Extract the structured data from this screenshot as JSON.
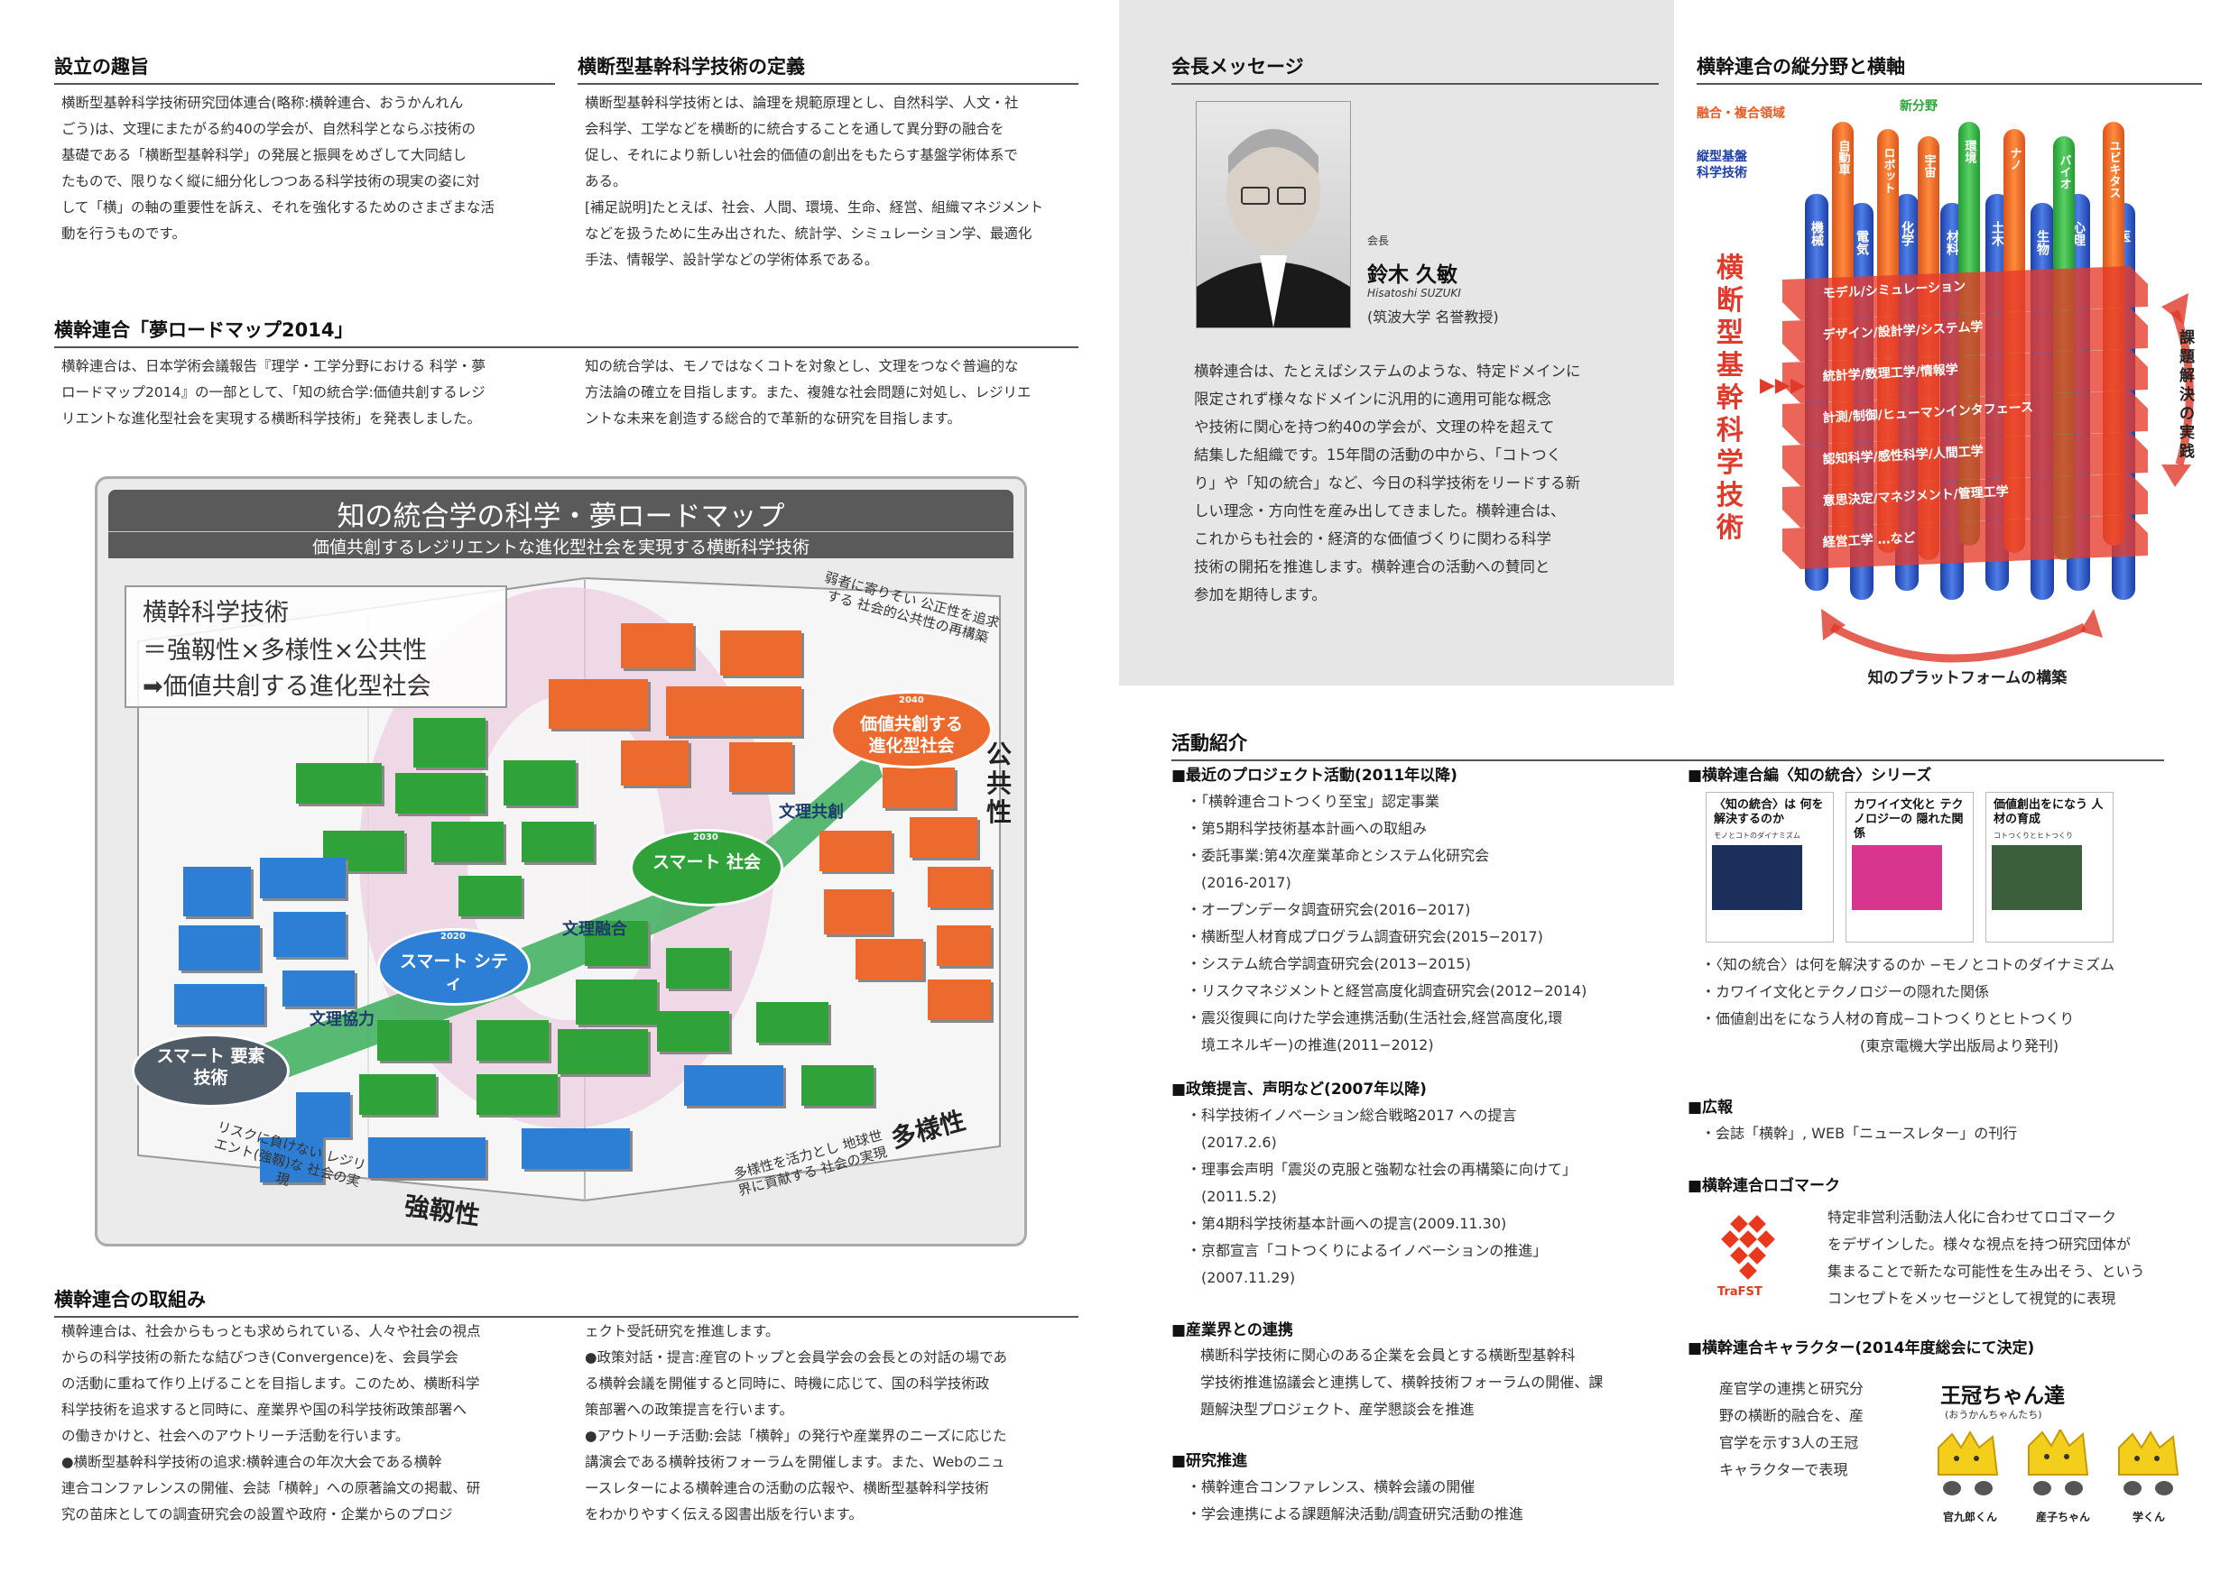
{
  "left": {
    "s1": {
      "title": "設立の趣旨",
      "body": [
        "横断型基幹科学技術研究団体連合(略称:横幹連合、おうかんれん",
        "ごう)は、文理にまたがる約40の学会が、自然科学とならぶ技術の",
        "基礎である「横断型基幹科学」の発展と振興をめざして大同結し",
        "たもので、限りなく縦に細分化しつつある科学技術の現実の姿に対",
        "して「横」の軸の重要性を訴え、それを強化するためのさまざまな活",
        "動を行うものです。"
      ]
    },
    "s2": {
      "title": "横断型基幹科学技術の定義",
      "body": [
        "横断型基幹科学技術とは、論理を規範原理とし、自然科学、人文・社",
        "会科学、工学などを横断的に統合することを通して異分野の融合を",
        "促し、それにより新しい社会的価値の創出をもたらす基盤学術体系で",
        "ある。",
        "[補足説明]たとえば、社会、人間、環境、生命、経営、組織マネジメント",
        "などを扱うために生み出された、統計学、シミュレーション学、最適化",
        "手法、情報学、設計学などの学術体系である。"
      ]
    },
    "s3": {
      "title": "横幹連合「夢ロードマップ2014」",
      "colA": [
        "横幹連合は、日本学術会議報告『理学・工学分野における 科学・夢",
        "ロードマップ2014』の一部として、「知の統合学:価値共創するレジ",
        "リエントな進化型社会を実現する横断科学技術」を発表しました。"
      ],
      "colB": [
        "知の統合学は、モノではなくコトを対象とし、文理をつなぐ普遍的な",
        "方法論の確立を目指します。また、複雑な社会問題に対処し、レジリエ",
        "ントな未来を創造する総合的で革新的な研究を目指します。"
      ]
    },
    "roadmap": {
      "title": "知の統合学の科学・夢ロードマップ",
      "subtitle": "価値共創するレジリエントな進化型社会を実現する横断科学技術",
      "formula1": "横幹科学技術",
      "formula2": "＝強靱性×多様性×公共性",
      "formula3": "➡価値共創する進化型社会",
      "e_element": "スマート 要素技術",
      "e_city": "スマート シティ",
      "e_society": "スマート 社会",
      "e_value": "価値共創する 進化型社会",
      "y2020": "2020",
      "y2030": "2030",
      "y2040": "2040",
      "a1": "文理協力",
      "a2": "文理融合",
      "a3": "文理共創",
      "axis_public": "公共性",
      "axis_diverse": "多様性",
      "axis_robust": "強靱性",
      "note_public": "弱者に寄りそい 公正性を追求する 社会的公共性の再構築",
      "note_diverse": "多様性を活力とし 地球世界に貢献する 社会の実現",
      "note_robust": "リスクに負けない レジリエント(強靱)な 社会の実現"
    },
    "s4": {
      "title": "横幹連合の取組み",
      "colA": [
        "横幹連合は、社会からもっとも求められている、人々や社会の視点",
        "からの科学技術の新たな結びつき(Convergence)を、会員学会",
        "の活動に重ねて作り上げることを目指します。このため、横断科学",
        "科学技術を追求すると同時に、産業界や国の科学技術政策部署へ",
        "の働きかけと、社会へのアウトリーチ活動を行います。",
        "●横断型基幹科学技術の追求:横幹連合の年次大会である横幹",
        "連合コンファレンスの開催、会誌「横幹」への原著論文の掲載、研",
        "究の苗床としての調査研究会の設置や政府・企業からのプロジ"
      ],
      "colB": [
        "ェクト受託研究を推進します。",
        "●政策対話・提言:産官のトップと会員学会の会長との対話の場であ",
        "る横幹会議を開催すると同時に、時機に応じて、国の科学技術政",
        "策部署への政策提言を行います。",
        "●アウトリーチ活動:会誌「横幹」の発行や産業界のニーズに応じた",
        "講演会である横幹技術フォーラムを開催します。また、Webのニュ",
        "ースレターによる横幹連合の活動の広報や、横断型基幹科学技術",
        "をわかりやすく伝える図書出版を行います。"
      ]
    }
  },
  "right": {
    "msg": {
      "title": "会長メッセージ",
      "role": "会長",
      "name": "鈴木 久敏",
      "romaji": "Hisatoshi SUZUKI",
      "affil": "(筑波大学 名誉教授)",
      "body": [
        "横幹連合は、たとえばシステムのような、特定ドメインに",
        "限定されず様々なドメインに汎用的に適用可能な概念",
        "や技術に関心を持つ約40の学会が、文理の枠を超えて",
        "結集した組織です。15年間の活動の中から、「コトつく",
        "り」や「知の統合」など、今日の科学技術をリードする新",
        "しい理念・方向性を産み出してきました。横幹連合は、",
        "これからも社会的・経済的な価値づくりに関わる科学",
        "技術の開拓を推進します。横幹連合の活動への賛同と",
        "参加を期待します。"
      ]
    },
    "fig": {
      "title": "横幹連合の縦分野と横軸",
      "lbl_fusion": "融合・複合領域",
      "lbl_new": "新分野",
      "lbl_vertical": "縦型基盤 科学技術",
      "vertical_big": "横断型基幹科学技術",
      "rows": [
        "モデル/シミュレーション",
        "デザイン/設計学/システム学",
        "統計学/数理工学/情報学",
        "計測/制御/ヒューマンインタフェース",
        "認知科学/感性科学/人間工学",
        "意思決定/マネジメント/管理工学",
        "経営工学 …など"
      ],
      "side": "課題解決の実践",
      "bottom": "知のプラットフォームの構築",
      "rods_blue": [
        "機械",
        "電気",
        "化学",
        "材料",
        "土木",
        "生物",
        "心理",
        "医"
      ],
      "rods_orange": [
        "自動車",
        "ロボット",
        "宇宙",
        "環境",
        "ナノ",
        "バイオ",
        "ユビキタス"
      ]
    },
    "act": {
      "title": "活動紹介",
      "p1": {
        "title": "■最近のプロジェクト活動(2011年以降)",
        "items": [
          "・「横幹連合コトつくり至宝」認定事業",
          "・第5期科学技術基本計画への取組み",
          "・委託事業:第4次産業革命とシステム化研究会",
          "　(2016-2017)",
          "・オープンデータ調査研究会(2016−2017)",
          "・横断型人材育成プログラム調査研究会(2015−2017)",
          "・システム統合学調査研究会(2013−2015)",
          "・リスクマネジメントと経営高度化調査研究会(2012−2014)",
          "・震災復興に向けた学会連携活動(生活社会,経営高度化,環",
          "　境エネルギー)の推進(2011−2012)"
        ]
      },
      "p2": {
        "title": "■政策提言、声明など(2007年以降)",
        "items": [
          "・科学技術イノベーション総合戦略2017 への提言",
          "　(2017.2.6)",
          "・理事会声明「震災の克服と強靭な社会の再構築に向けて」",
          "　(2011.5.2)",
          "・第4期科学技術基本計画への提言(2009.11.30)",
          "・京都宣言「コトつくりによるイノベーションの推進」",
          "　(2007.11.29)"
        ]
      },
      "p3": {
        "title": "■産業界との連携",
        "items": [
          "横断科学技術に関心のある企業を会員とする横断型基幹科",
          "学技術推進協議会と連携して、横幹技術フォーラムの開催、課",
          "題解決型プロジェクト、産学懇談会を推進"
        ]
      },
      "p4": {
        "title": "■研究推進",
        "items": [
          "・横幹連合コンファレンス、横幹会議の開催",
          "・学会連携による課題解決活動/調査研究活動の推進"
        ]
      },
      "p5": {
        "title": "■横幹連合編〈知の統合〉シリーズ",
        "books": [
          {
            "t": "〈知の統合〉は 何を解決するのか",
            "s": "モノとコトのダイナミズム"
          },
          {
            "t": "カワイイ文化と テクノロジーの 隠れた関係",
            "s": ""
          },
          {
            "t": "価値創出をになう 人材の育成",
            "s": "コトつくりとヒトつくり"
          }
        ],
        "items": [
          "・〈知の統合〉は何を解決するのか −モノとコトのダイナミズム",
          "・カワイイ文化とテクノロジーの隠れた関係",
          "・価値創出をになう人材の育成−コトつくりとヒトつくり",
          "　　　　　　　　　　　(東京電機大学出版局より発刊)"
        ]
      },
      "p6": {
        "title": "■広報",
        "items": [
          "・会誌「横幹」, WEB「ニュースレター」の刊行"
        ]
      },
      "p7": {
        "title": "■横幹連合ロゴマーク",
        "logo": "TraFST",
        "items": [
          "特定非営利活動法人化に合わせてロゴマーク",
          "をデザインした。様々な視点を持つ研究団体が",
          "集まることで新たな可能性を生み出そう、という",
          "コンセプトをメッセージとして視覚的に表現"
        ]
      },
      "p8": {
        "title": "■横幹連合キャラクター(2014年度総会にて決定)",
        "items": [
          "産官学の連携と研究分",
          "野の横断的融合を、産",
          "官学を示す3人の王冠",
          "キャラクターで表現"
        ],
        "chars_title": "王冠ちゃん達",
        "chars_sub": "(おうかんちゃんたち)",
        "c1": "官九郎くん",
        "c2": "産子ちゃん",
        "c3": "学くん"
      }
    }
  }
}
